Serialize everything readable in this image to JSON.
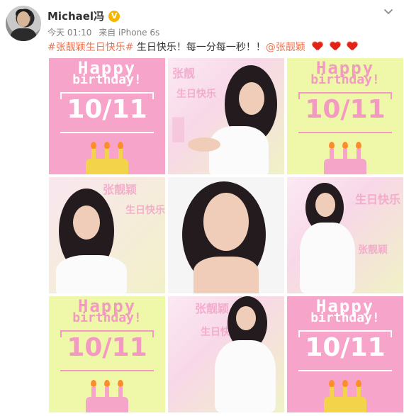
{
  "post": {
    "username": "Michael冯",
    "verified_badge": "V",
    "meta": {
      "time": "今天 01:10",
      "source": "来自 iPhone 6s"
    },
    "text": {
      "hashtag": "#张靓颖生日快乐#",
      "message": " 生日快乐！每一分每一秒！！",
      "mention": "@张靓颖"
    },
    "heart_count_display": 3,
    "colors": {
      "link": "#eb7350",
      "pink_tile": "#f6a4ca",
      "yellow_tile": "#eff7a8",
      "heart": "#e2231a"
    }
  },
  "images": [
    {
      "type": "card",
      "theme": "pink",
      "happy": "Happy",
      "birthday": "birthday!",
      "date": "10/11"
    },
    {
      "type": "photo",
      "theme": "pink"
    },
    {
      "type": "card",
      "theme": "yellow",
      "happy": "Happy",
      "birthday": "birthday!",
      "date": "10/11"
    },
    {
      "type": "photo",
      "theme": "yellow"
    },
    {
      "type": "photo",
      "theme": "white"
    },
    {
      "type": "photo",
      "theme": "yellow"
    },
    {
      "type": "card",
      "theme": "yellow",
      "happy": "Happy",
      "birthday": "birthday!",
      "date": "10/11"
    },
    {
      "type": "photo",
      "theme": "pink"
    },
    {
      "type": "card",
      "theme": "pink",
      "happy": "Happy",
      "birthday": "birthday!",
      "date": "10/11"
    }
  ]
}
